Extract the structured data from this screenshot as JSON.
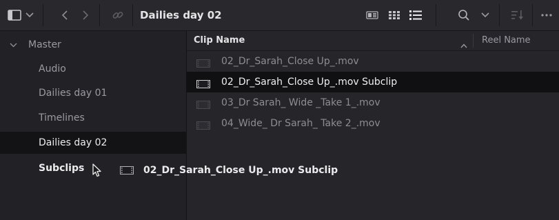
{
  "toolbar": {
    "title": "Dailies day 02",
    "icons": [
      "sidebar-toggle-icon",
      "chevron-down-icon",
      "back-arrow-icon",
      "forward-arrow-icon",
      "link-icon",
      "metadata-view-icon",
      "grid-view-icon",
      "list-view-icon",
      "search-icon",
      "chevron-down-icon",
      "sort-icon",
      "more-icon"
    ]
  },
  "sidebar": {
    "master": "Master",
    "items": [
      {
        "label": "Audio"
      },
      {
        "label": "Dailies day 01"
      },
      {
        "label": "Timelines"
      },
      {
        "label": "Dailies day 02",
        "selected": true
      },
      {
        "label": "Subclips"
      }
    ]
  },
  "columns": {
    "clip_name": "Clip Name",
    "reel_name": "Reel Name"
  },
  "clips": [
    {
      "name": "02_Dr_Sarah_Close Up_.mov"
    },
    {
      "name": "02_Dr_Sarah_Close Up_.mov Subclip",
      "selected": true
    },
    {
      "name": "03_Dr Sarah_ Wide _Take 1_.mov"
    },
    {
      "name": "04_Wide_ Dr Sarah_ Take 2_.mov"
    }
  ],
  "drag": {
    "name": "02_Dr_Sarah_Close Up_.mov Subclip"
  },
  "colors": {
    "toolbar_bg": "#29292d",
    "sidebar_bg": "#222226",
    "list_bg": "#25252a",
    "selected_bg": "#131315"
  }
}
